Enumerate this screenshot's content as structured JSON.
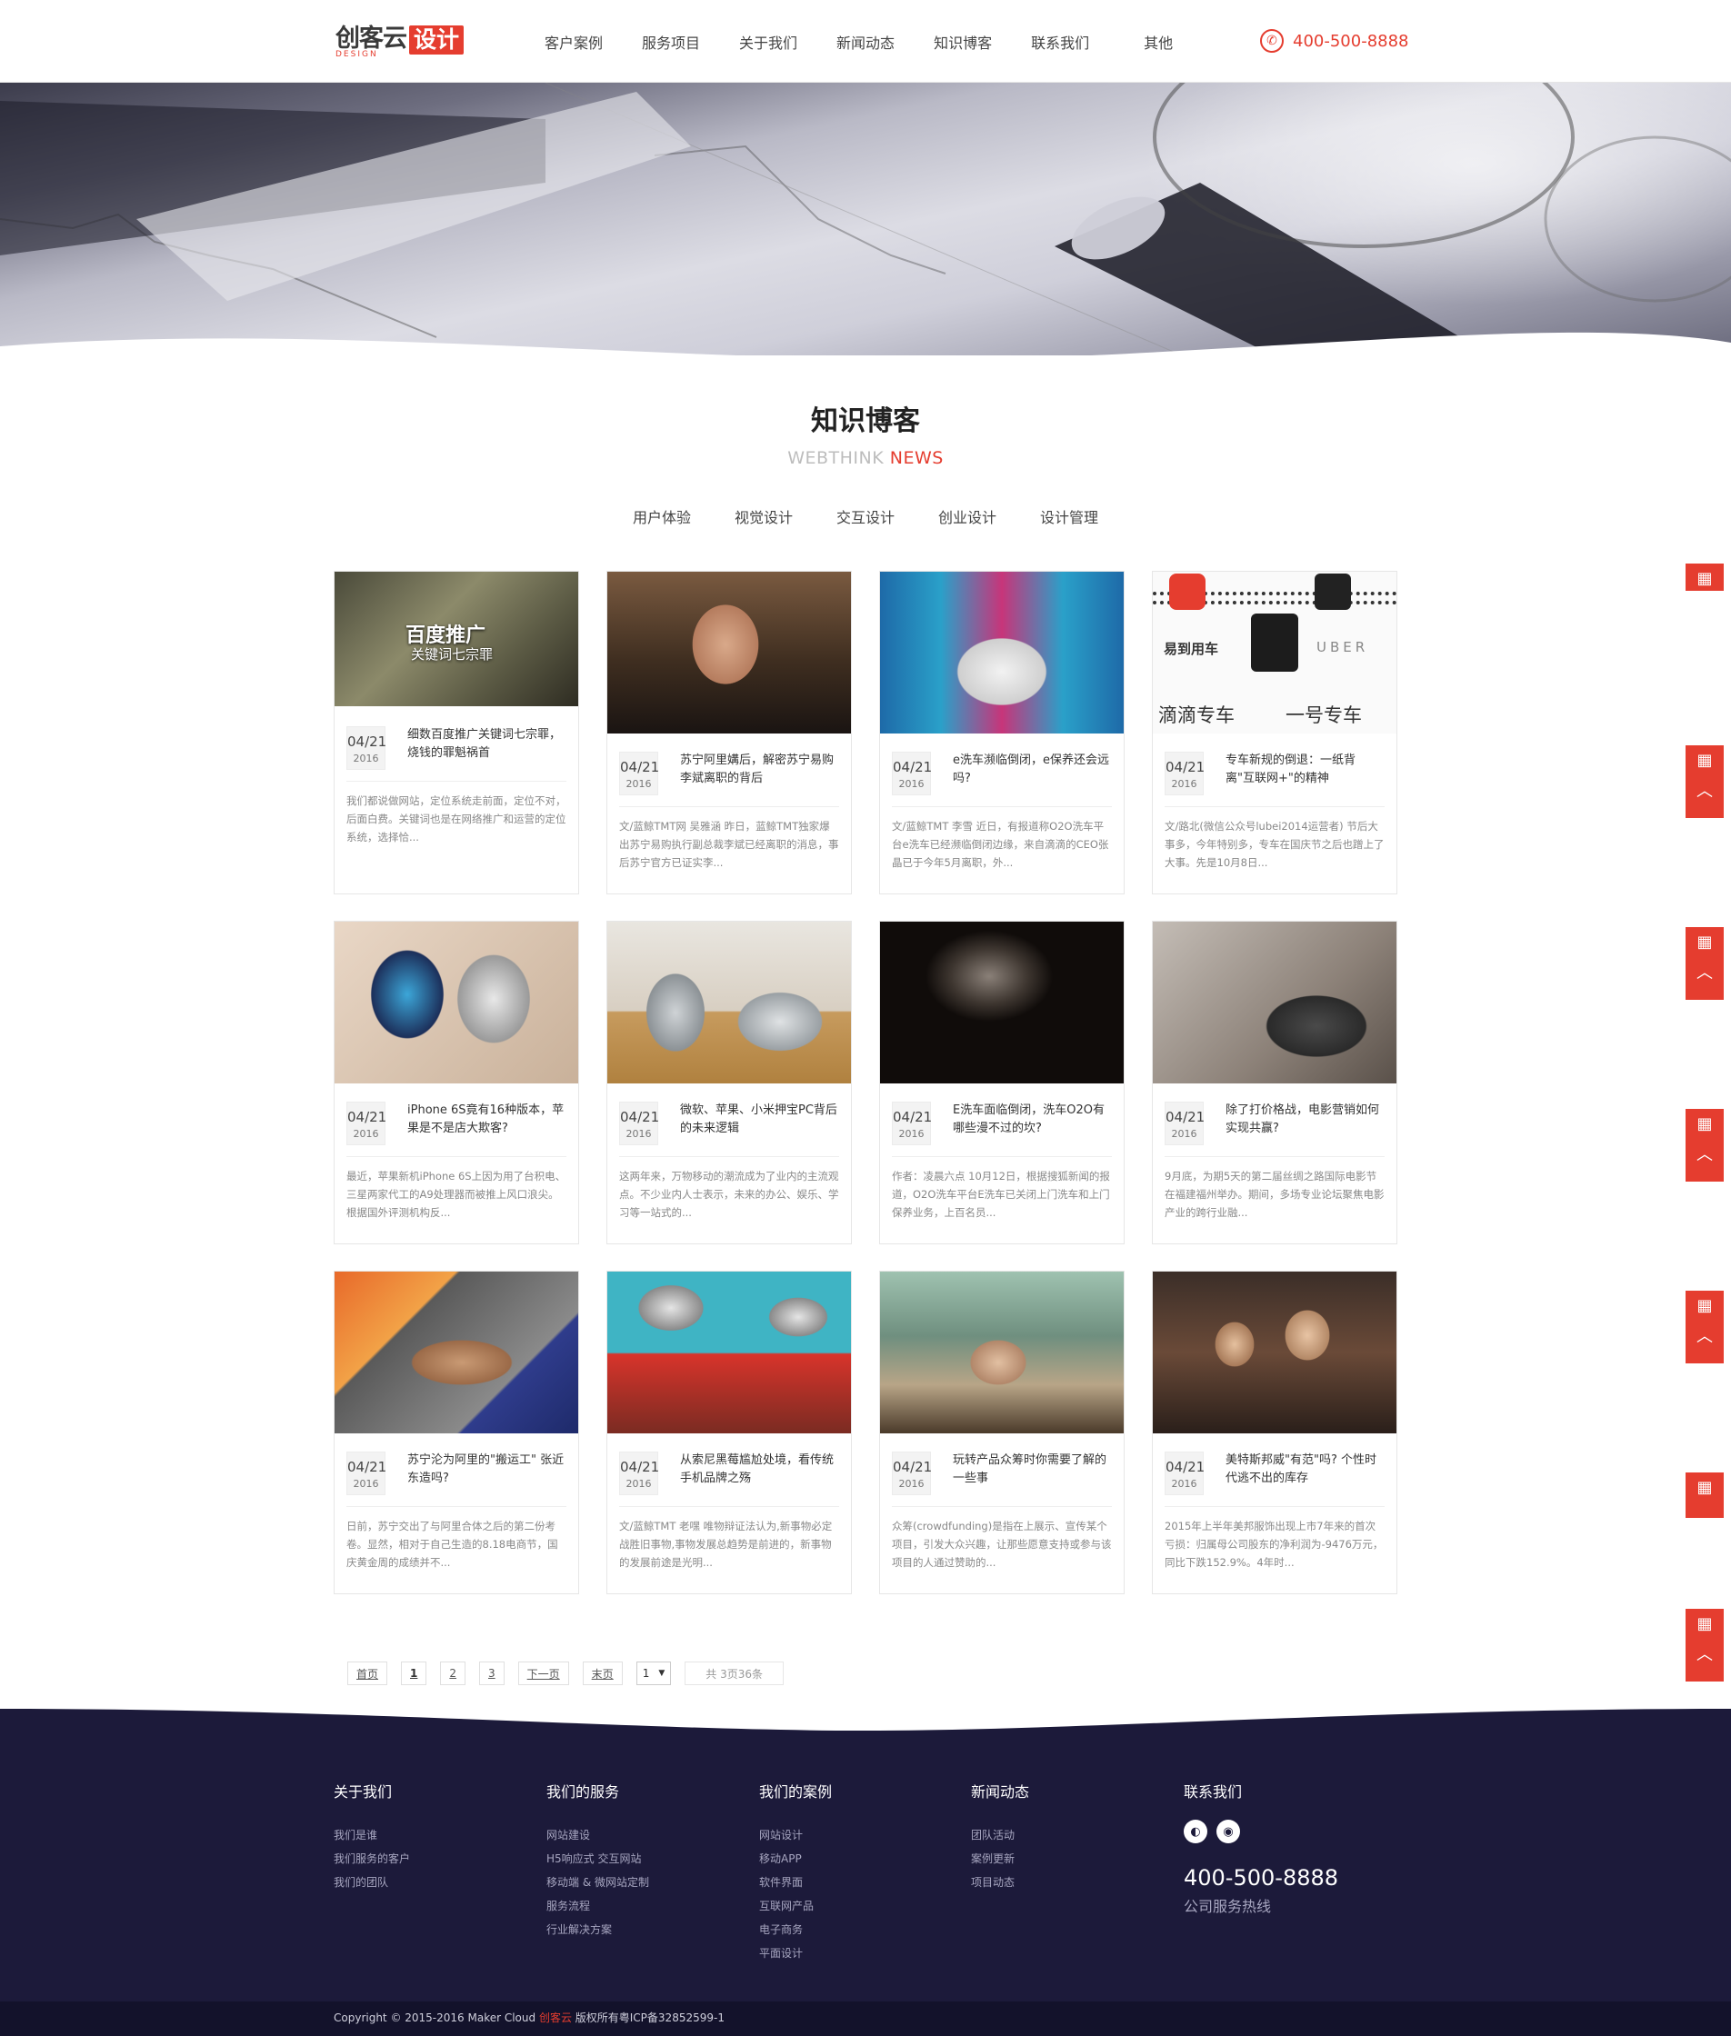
{
  "brand": {
    "logo_main": "创客云",
    "logo_sub": "DESIGN",
    "logo_box": "设计",
    "accent": "#e53d2f"
  },
  "nav": [
    "客户案例",
    "服务项目",
    "关于我们",
    "新闻动态",
    "知识博客",
    "联系我们",
    "其他"
  ],
  "header_phone": "400-500-8888",
  "section": {
    "title": "知识博客",
    "sub_a": "WEBTHINK",
    "sub_b": "NEWS"
  },
  "tabs": [
    "用户体验",
    "视觉设计",
    "交互设计",
    "创业设计",
    "设计管理"
  ],
  "posts": [
    {
      "date": "04/21",
      "year": "2016",
      "title": "细数百度推广关键词七宗罪，烧钱的罪魁祸首",
      "excerpt": "我们都说做网站，定位系统走前面，定位不对，后面白费。关键词也是在网络推广和运营的定位系统，选择恰...",
      "thumb_text": "百度推广",
      "thumb_text2": "关键词七宗罪"
    },
    {
      "date": "04/21",
      "year": "2016",
      "title": "苏宁阿里媾后，解密苏宁易购李斌离职的背后",
      "excerpt": "文/蓝鲸TMT网 吴雅涵 昨日，蓝鲸TMT独家爆出苏宁易购执行副总裁李斌已经离职的消息，事后苏宁官方已证实李..."
    },
    {
      "date": "04/21",
      "year": "2016",
      "title": "e洗车濒临倒闭，e保养还会远吗?",
      "excerpt": "文/蓝鲸TMT 李雪 近日，有报道称O2O洗车平台e洗车已经濒临倒闭边缘，来自滴滴的CEO张晶已于今年5月离职，外..."
    },
    {
      "date": "04/21",
      "year": "2016",
      "title": "专车新规的倒退：一纸背离\"互联网+\"的精神",
      "excerpt": "文/路北(微信公众号lubei2014运营者) 节后大事多，今年特别多，专车在国庆节之后也蹭上了大事。先是10月8日...",
      "thumb_a": "易到用车",
      "thumb_b": "UBER",
      "thumb_c": "滴滴专车",
      "thumb_d": "一号专车"
    },
    {
      "date": "04/21",
      "year": "2016",
      "title": "iPhone 6S竟有16种版本，苹果是不是店大欺客?",
      "excerpt": "最近，苹果新机iPhone 6S上因为用了台积电、三星两家代工的A9处理器而被推上风口浪尖。根据国外评测机构反..."
    },
    {
      "date": "04/21",
      "year": "2016",
      "title": "微软、苹果、小米押宝PC背后的未来逻辑",
      "excerpt": "这两年来，万物移动的潮流成为了业内的主流观点。不少业内人士表示，未来的办公、娱乐、学习等一站式的..."
    },
    {
      "date": "04/21",
      "year": "2016",
      "title": "E洗车面临倒闭，洗车O2O有哪些漫不过的坎?",
      "excerpt": "作者：凌晨六点 10月12日，根据搜狐新闻的报道，O2O洗车平台E洗车已关闭上门洗车和上门保养业务，上百名员..."
    },
    {
      "date": "04/21",
      "year": "2016",
      "title": "除了打价格战，电影营销如何实现共赢?",
      "excerpt": "9月底，为期5天的第二届丝绸之路国际电影节在福建福州举办。期间，多场专业论坛聚焦电影产业的跨行业融..."
    },
    {
      "date": "04/21",
      "year": "2016",
      "title": "苏宁沦为阿里的\"搬运工\" 张近东造吗?",
      "excerpt": "日前，苏宁交出了与阿里合体之后的第二份考卷。显然，相对于自己生造的8.18电商节，国庆黄金周的成绩并不..."
    },
    {
      "date": "04/21",
      "year": "2016",
      "title": "从索尼黑莓尴尬处境，看传统手机品牌之殇",
      "excerpt": "文/蓝鲸TMT 老嘿 唯物辩证法认为,新事物必定战胜旧事物,事物发展总趋势是前进的，新事物的发展前途是光明..."
    },
    {
      "date": "04/21",
      "year": "2016",
      "title": "玩转产品众筹时你需要了解的一些事",
      "excerpt": "众筹(crowdfunding)是指在上展示、宣传某个项目，引发大众兴趣，让那些愿意支持或参与该项目的人通过赞助的..."
    },
    {
      "date": "04/21",
      "year": "2016",
      "title": "美特斯邦威\"有范\"吗? 个性时代逃不出的库存",
      "excerpt": "2015年上半年美邦服饰出现上市7年来的首次亏损：归属母公司股东的净利润为-9476万元，同比下跌152.9%。4年时..."
    }
  ],
  "pager": {
    "first": "首页",
    "p1": "1",
    "p2": "2",
    "p3": "3",
    "next": "下一页",
    "last": "末页",
    "select": "1",
    "info": "共 3页36条"
  },
  "footer": {
    "about_title": "关于我们",
    "about": [
      "我们是谁",
      "我们服务的客户",
      "我们的团队"
    ],
    "service_title": "我们的服务",
    "service": [
      "网站建设",
      "H5响应式 交互网站",
      "移动端 & 微网站定制",
      "服务流程",
      "行业解决方案"
    ],
    "cases_title": "我们的案例",
    "cases": [
      "网站设计",
      "移动APP",
      "软件界面",
      "互联网产品",
      "电子商务",
      "平面设计"
    ],
    "news_title": "新闻动态",
    "news": [
      "团队活动",
      "案例更新",
      "项目动态"
    ],
    "contact_title": "联系我们",
    "phone": "400-500-8888",
    "phone_label": "公司服务热线"
  },
  "copyright": {
    "a": "Copyright © 2015-2016 Maker Cloud ",
    "b": "创客云",
    "c": " 版权所有粤ICP备32852599-1"
  }
}
